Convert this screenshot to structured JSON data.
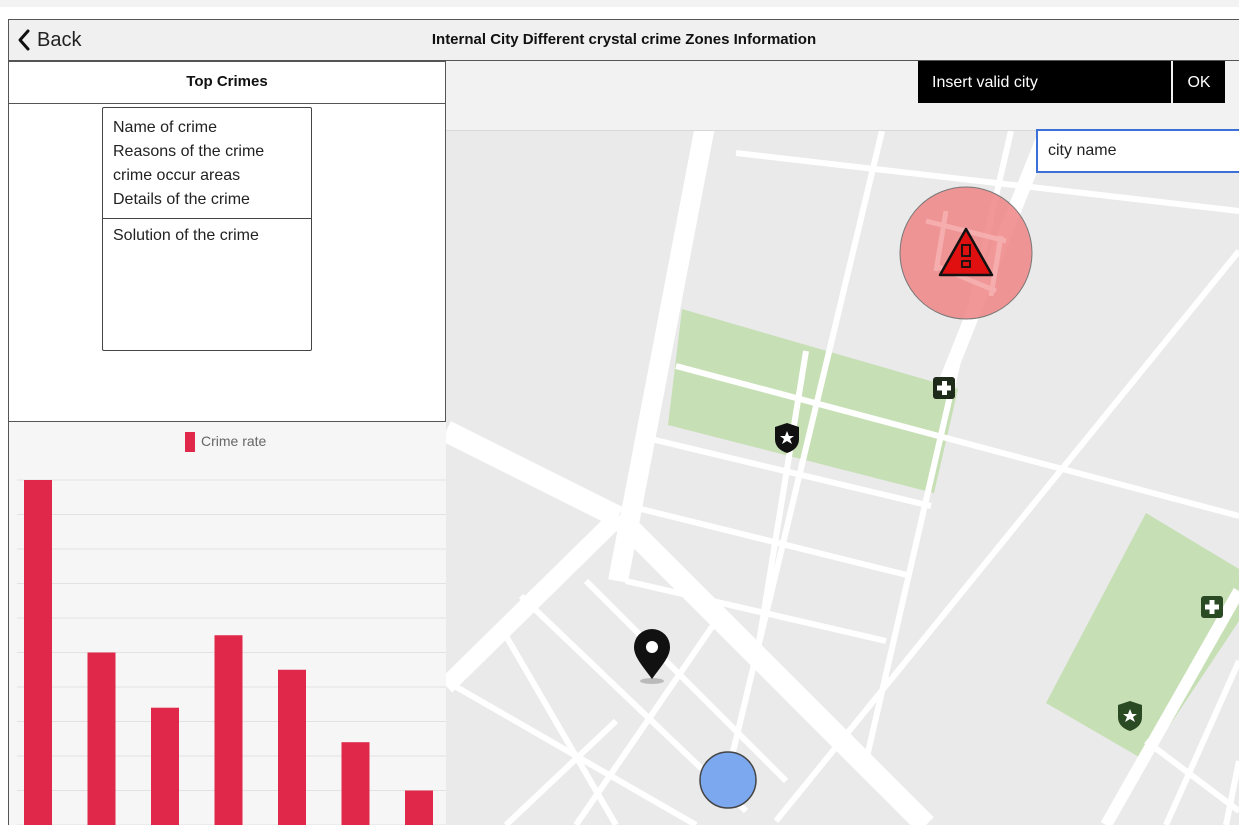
{
  "header": {
    "back_label": "Back",
    "title": "Internal City Different crystal crime Zones Information"
  },
  "sidebar": {
    "title": "Top Crimes",
    "details": [
      "Name of crime",
      "Reasons of the crime",
      "crime occur areas",
      "Details of the crime"
    ],
    "solution": "Solution of the crime"
  },
  "chart_data": {
    "type": "bar",
    "series": [
      {
        "name": "Crime rate",
        "values": [
          100,
          50,
          34,
          55,
          45,
          24,
          10
        ],
        "color": "#e0284a"
      }
    ],
    "ylim": [
      0,
      100
    ],
    "grid": true,
    "legend": "top-center"
  },
  "search": {
    "label": "Insert valid city",
    "ok_label": "OK",
    "placeholder": "city name"
  },
  "map": {
    "icons": [
      "danger-warning-icon",
      "hospital-icon",
      "police-shield-icon",
      "location-pin-icon",
      "current-location-icon"
    ],
    "colors": {
      "danger_zone": "#ee8585",
      "park": "#c6dfb4",
      "road": "#ffffff",
      "current_location": "#7ba8ee"
    }
  }
}
